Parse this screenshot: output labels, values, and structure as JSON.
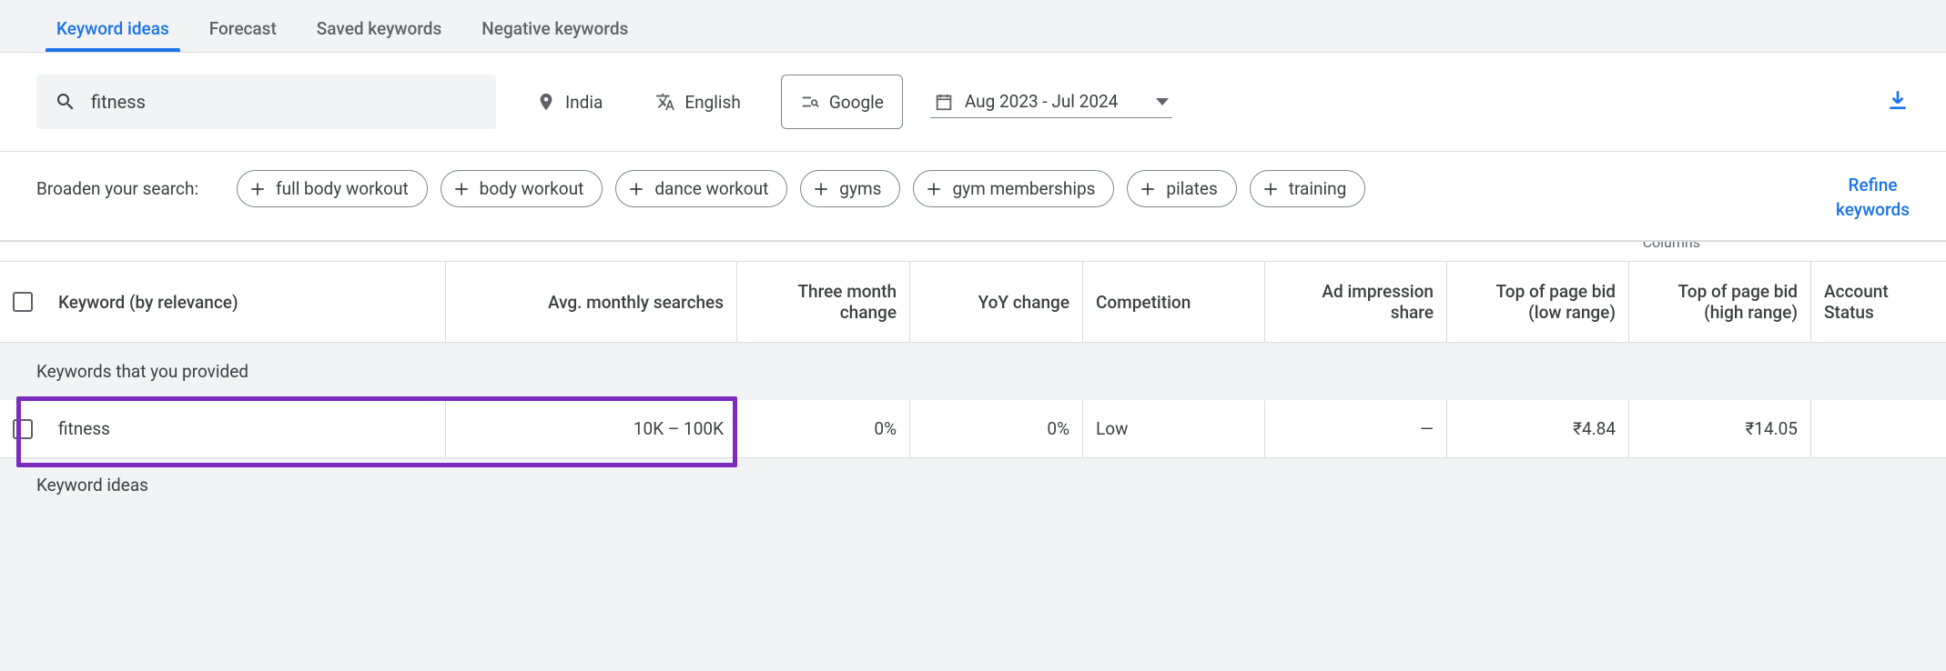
{
  "tabs": [
    {
      "label": "Keyword ideas",
      "active": true
    },
    {
      "label": "Forecast",
      "active": false
    },
    {
      "label": "Saved keywords",
      "active": false
    },
    {
      "label": "Negative keywords",
      "active": false
    }
  ],
  "search": {
    "value": "fitness",
    "location": "India",
    "language": "English",
    "network": "Google",
    "date_range": "Aug 2023 - Jul 2024"
  },
  "broaden": {
    "label": "Broaden your search:",
    "chips": [
      "full body workout",
      "body workout",
      "dance workout",
      "gyms",
      "gym memberships",
      "pilates",
      "training"
    ]
  },
  "refine_label": "Refine keywords",
  "columns_hint": "Columns",
  "headers": {
    "keyword": "Keyword (by relevance)",
    "avg": "Avg. monthly searches",
    "three_month": "Three month change",
    "yoy": "YoY change",
    "competition": "Competition",
    "ad_impr": "Ad impression share",
    "bid_low": "Top of page bid (low range)",
    "bid_high": "Top of page bid (high range)",
    "account": "Account Status"
  },
  "section_provided": "Keywords that you provided",
  "section_ideas": "Keyword ideas",
  "rows": [
    {
      "keyword": "fitness",
      "avg": "10K – 100K",
      "three_month": "0%",
      "yoy": "0%",
      "competition": "Low",
      "ad_impr": "—",
      "bid_low": "₹4.84",
      "bid_high": "₹14.05",
      "account": ""
    }
  ]
}
